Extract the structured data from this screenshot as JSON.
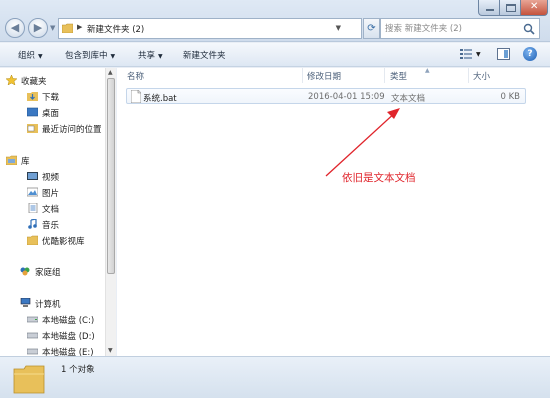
{
  "window": {
    "breadcrumb_folder": "新建文件夹 (2)",
    "search_placeholder": "搜索 新建文件夹 (2)"
  },
  "toolbar": {
    "organize": "组织",
    "include_in_library": "包含到库中",
    "share": "共享",
    "new_folder": "新建文件夹"
  },
  "nav": {
    "favorites": "收藏夹",
    "downloads": "下载",
    "desktop": "桌面",
    "recent": "最近访问的位置",
    "libraries": "库",
    "videos": "视频",
    "pictures": "图片",
    "documents": "文档",
    "music": "音乐",
    "youku": "优酷影视库",
    "homegroup": "家庭组",
    "computer": "计算机",
    "drive_c": "本地磁盘 (C:)",
    "drive_d": "本地磁盘 (D:)",
    "drive_e": "本地磁盘 (E:)"
  },
  "columns": {
    "name": "名称",
    "modified": "修改日期",
    "type": "类型",
    "size": "大小"
  },
  "file": {
    "name": "系统.bat",
    "modified": "2016-04-01 15:09",
    "type": "文本文档",
    "size": "0 KB"
  },
  "annotation": "依旧是文本文档",
  "status": {
    "count": "1 个对象"
  },
  "colors": {
    "annotation": "#e0242b",
    "folder": "#e8c05a"
  }
}
